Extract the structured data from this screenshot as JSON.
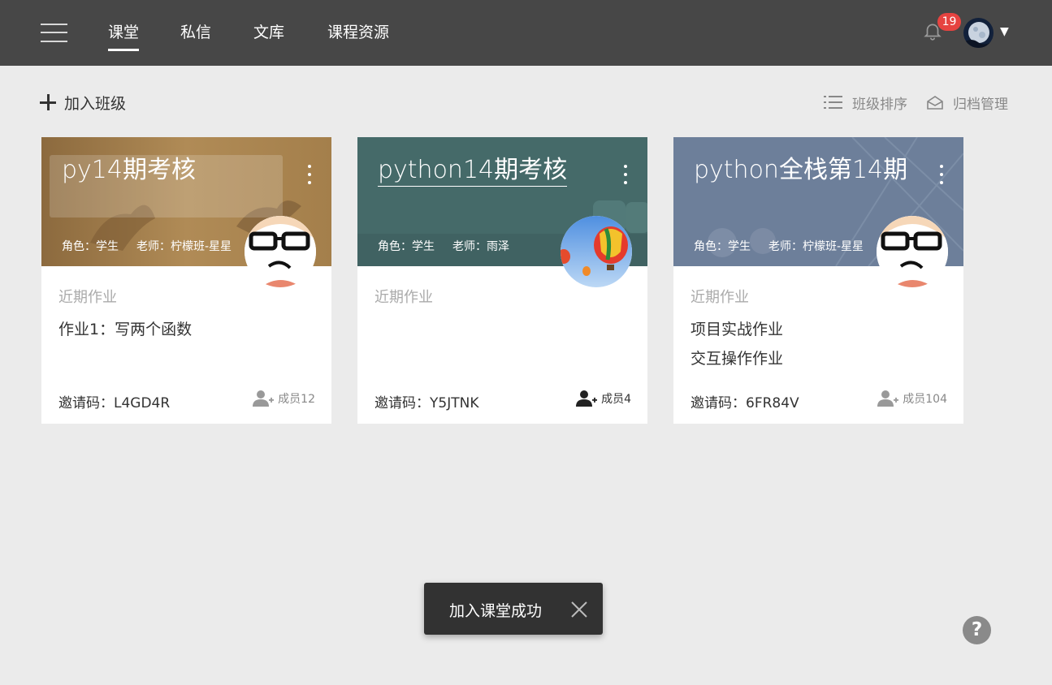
{
  "nav": {
    "items": [
      {
        "label": "课堂",
        "active": true
      },
      {
        "label": "私信",
        "active": false
      },
      {
        "label": "文库",
        "active": false
      },
      {
        "label": "课程资源",
        "active": false
      }
    ],
    "notification_count": "19",
    "user_menu_caret": "▼"
  },
  "toolbar": {
    "add_class": "加入班级",
    "sort_label": "班级排序",
    "archive_label": "归档管理"
  },
  "cards": [
    {
      "title": "py14期考核",
      "role": "角色：学生",
      "teacher": "老师：柠檬班-星星",
      "recent_label": "近期作业",
      "assignments": [
        "作业1：写两个函数"
      ],
      "invite": "邀请码：L4GD4R",
      "members": "成员12",
      "theme_color": "#a9824e",
      "avatar_icon": "cartoon-face-avatar"
    },
    {
      "title": "python14期考核",
      "role": "角色：学生",
      "teacher": "老师：雨泽",
      "recent_label": "近期作业",
      "assignments": [],
      "invite": "邀请码：Y5JTNK",
      "members": "成员4",
      "theme_color": "#456a69",
      "avatar_icon": "hot-air-balloon-avatar"
    },
    {
      "title": "python全栈第14期",
      "role": "角色：学生",
      "teacher": "老师：柠檬班-星星",
      "recent_label": "近期作业",
      "assignments": [
        "项目实战作业",
        "交互操作作业"
      ],
      "invite": "邀请码：6FR84V",
      "members": "成员104",
      "theme_color": "#6d7f9a",
      "avatar_icon": "cartoon-face-avatar"
    }
  ],
  "toast": {
    "message": "加入课堂成功"
  },
  "help": {
    "label": "?"
  },
  "colors": {
    "topbar": "#474747",
    "background": "#ebebeb",
    "badge": "#e64340",
    "toast": "#323232"
  }
}
